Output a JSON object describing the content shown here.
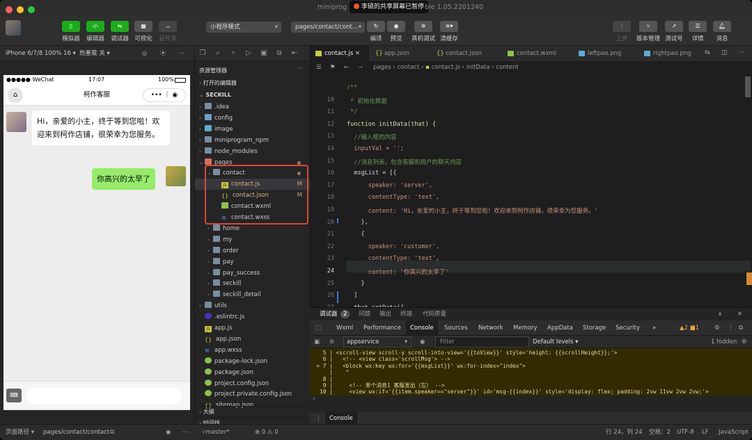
{
  "window": {
    "title_left": "miniprog",
    "title_right": "ble 1.05.2201240",
    "share_notice": "李硕的共享屏幕已暂停"
  },
  "toolbar": {
    "simulator": "模拟器",
    "editor": "编辑器",
    "debugger": "调试器",
    "visual": "可视化",
    "cloud": "云开发",
    "mode_select": "小程序模式",
    "page_select": "pages/contact/cont...",
    "compile": "编译",
    "preview": "预览",
    "real_debug": "真机调试",
    "clear_cache": "清缓存",
    "upload": "上传",
    "version_mgmt": "版本管理",
    "test_id": "测试号",
    "details": "详情",
    "messages": "消息"
  },
  "simulator": {
    "device": "iPhone 6/7/8 100% 16 ▾",
    "hot_reload": "热重载 关 ▾",
    "status_left": "●●●●● WeChat",
    "status_time": "17:07",
    "status_battery": "100%",
    "nav_title": "柯作客服",
    "messages": [
      {
        "speaker": "server",
        "text": "Hi，亲爱的小主，终于等到您啦！欢迎来到柯作店铺，很荣幸为您服务。"
      },
      {
        "speaker": "customer",
        "text": "你高兴的太早了"
      }
    ]
  },
  "explorer": {
    "title": "资源管理器",
    "open_editors": "打开的编辑器",
    "project": "SECKILL",
    "items": [
      {
        "label": ".idea",
        "kind": "folder"
      },
      {
        "label": "config",
        "kind": "folder-cfg"
      },
      {
        "label": "image",
        "kind": "folder-image"
      },
      {
        "label": "miniprogram_npm",
        "kind": "folder"
      },
      {
        "label": "node_modules",
        "kind": "folder"
      },
      {
        "label": "pages",
        "kind": "folder-pages"
      },
      {
        "label": "contact",
        "kind": "folder"
      },
      {
        "label": "contact.js",
        "kind": "js",
        "badge": "M"
      },
      {
        "label": "contact.json",
        "kind": "json",
        "badge": "M"
      },
      {
        "label": "contact.wxml",
        "kind": "wxml"
      },
      {
        "label": "contact.wxss",
        "kind": "wxss"
      },
      {
        "label": "home",
        "kind": "folder"
      },
      {
        "label": "my",
        "kind": "folder"
      },
      {
        "label": "order",
        "kind": "folder"
      },
      {
        "label": "pay",
        "kind": "folder"
      },
      {
        "label": "pay_success",
        "kind": "folder"
      },
      {
        "label": "seckill",
        "kind": "folder"
      },
      {
        "label": "seckill_detail",
        "kind": "folder"
      },
      {
        "label": "utils",
        "kind": "folder"
      },
      {
        "label": ".eslintrc.js",
        "kind": "js-eslint"
      },
      {
        "label": "app.js",
        "kind": "js"
      },
      {
        "label": "app.json",
        "kind": "json"
      },
      {
        "label": "app.wxss",
        "kind": "wxss"
      },
      {
        "label": "package-lock.json",
        "kind": "pkg"
      },
      {
        "label": "package.json",
        "kind": "pkg"
      },
      {
        "label": "project.config.json",
        "kind": "pkg"
      },
      {
        "label": "project.private.config.json",
        "kind": "pkg"
      },
      {
        "label": "sitemap.json",
        "kind": "json"
      }
    ],
    "outline": "大纲",
    "timeline": "时间线"
  },
  "editor": {
    "tabs": [
      "contact.js",
      "app.json",
      "contact.json",
      "contact.wxml",
      "leftpao.png",
      "rightpao.png"
    ],
    "breadcrumb": [
      "pages",
      "contact",
      "contact.js",
      "initData",
      "content"
    ],
    "lines": [
      {
        "n": "",
        "t": "/**"
      },
      {
        "n": "10",
        "t": " * 初始化数据"
      },
      {
        "n": "11",
        "t": " */"
      },
      {
        "n": "12",
        "t": "function initData(that) {"
      },
      {
        "n": "13",
        "t": "  //输入框的内容"
      },
      {
        "n": "14",
        "t": "  inputVal = '';"
      },
      {
        "n": "15",
        "t": "  //消息列表，包含客服和用户的聊天内容"
      },
      {
        "n": "16",
        "t": "  msgList = [{"
      },
      {
        "n": "17",
        "t": "      speaker: 'server',"
      },
      {
        "n": "18",
        "t": "      contentType: 'text',"
      },
      {
        "n": "19",
        "t": "      content: 'Hi，亲爱的小主，终于等到您啦！欢迎来到柯作店铺，很荣幸为您服务。'"
      },
      {
        "n": "20",
        "t": "    },"
      },
      {
        "n": "21",
        "t": "    {"
      },
      {
        "n": "22",
        "t": "      speaker: 'customer',"
      },
      {
        "n": "23",
        "t": "      contentType: 'text',"
      },
      {
        "n": "24",
        "t": "      content: '你高兴的太早了'"
      },
      {
        "n": "25",
        "t": "    }"
      },
      {
        "n": "26",
        "t": "  ]"
      },
      {
        "n": "27",
        "t": "  that.setData({"
      }
    ]
  },
  "devtools": {
    "tabs": [
      "调试器",
      "2",
      "问题",
      "输出",
      "终端",
      "代码质量"
    ],
    "chrome_tabs": [
      "Wxml",
      "Performance",
      "Console",
      "Sources",
      "Network",
      "Memory",
      "AppData",
      "Storage",
      "Security",
      "»"
    ],
    "badges": "▲2 ■1",
    "context": "appservice",
    "filter_placeholder": "Filter",
    "levels": "Default levels ▾",
    "hidden": "1 hidden",
    "console_lines": [
      "    5 | <scroll-view scroll-y scroll-into-view='{{toView}}' style='height: {{scrollHeight}};'>",
      "    6 |   <!-- <view class='scrollMsg'> -->",
      "  > 7 |   <block wx:key wx:for='{{msgList}}' wx:for-index=\"index\">",
      "      |    ^",
      "    8 |",
      "    9 |     <!-- 单个消息1 客服发出（左） -->",
      "   10 |     <view wx:if='{{item.speaker==\"server\"}}' id='msg-{{index}}' style='display: flex; padding: 2vw 11vw 2vw 2vw;'>"
    ],
    "prompt": "›",
    "drawer_tab": "Console"
  },
  "statusbar": {
    "page_path_label": "页面路径 ▾",
    "page_path": "pages/contact/contact",
    "branch": "master*",
    "problems": "⊗ 0 ⚠ 0",
    "position": "行 24，列 24",
    "spaces": "空格：2",
    "encoding": "UTF-8",
    "eol": "LF",
    "language": "JavaScript"
  },
  "colors": {
    "accent_green": "#1aad19",
    "highlight_red": "#e0443a",
    "bubble_green": "#95ec69"
  }
}
